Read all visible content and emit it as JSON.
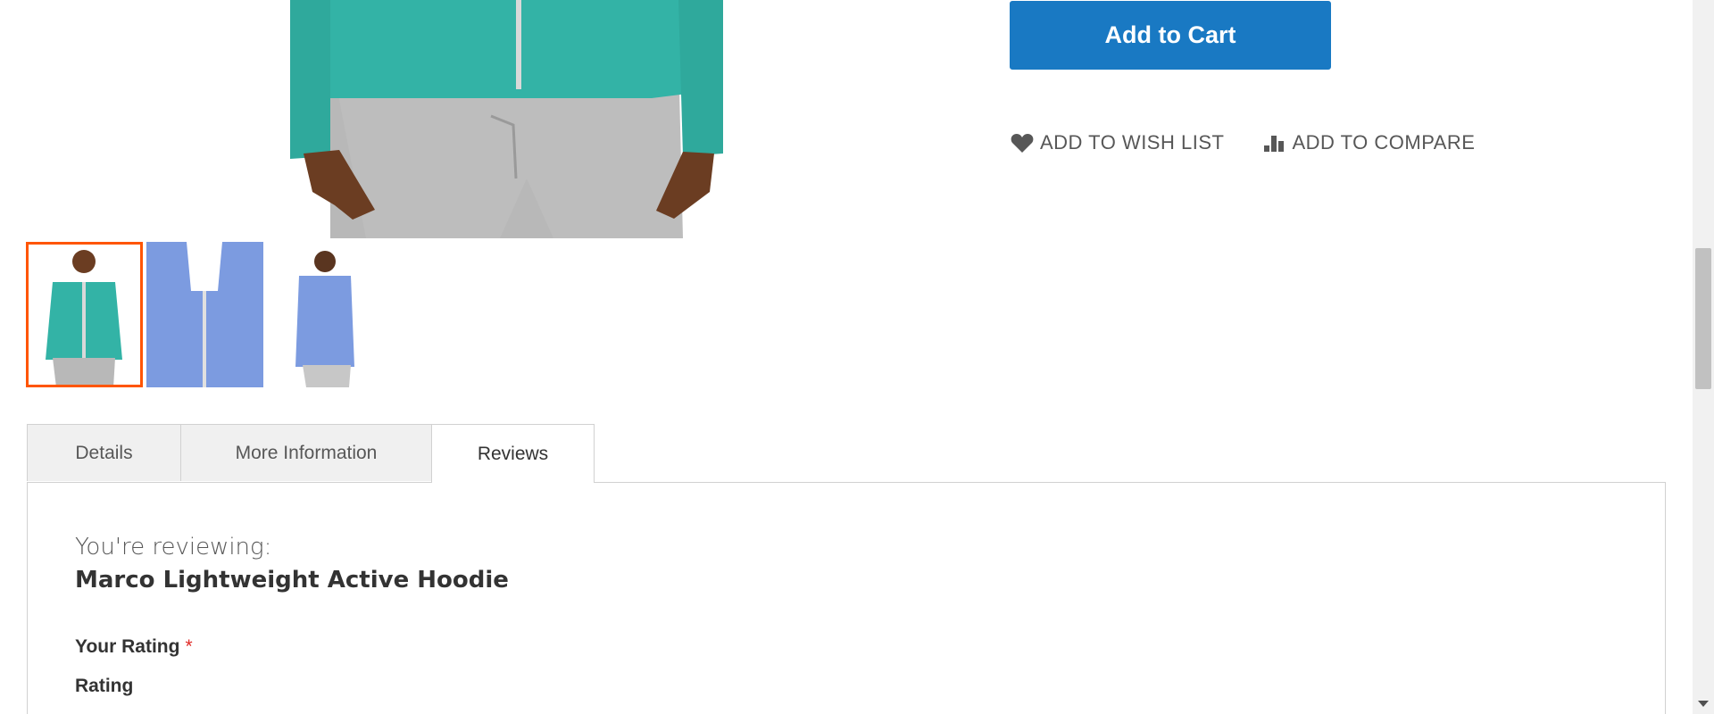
{
  "product": {
    "add_to_cart_label": "Add to Cart",
    "wishlist_label": "ADD TO WISH LIST",
    "compare_label": "ADD TO COMPARE",
    "colors": {
      "primary_button": "#1979c3",
      "active_thumb_border": "#ff5501",
      "hoodie_teal": "#33b3a6",
      "hoodie_blue": "#7c9be0",
      "required_star": "#e02b27"
    }
  },
  "tabs": [
    {
      "label": "Details",
      "active": false
    },
    {
      "label": "More Information",
      "active": false
    },
    {
      "label": "Reviews",
      "active": true
    }
  ],
  "review": {
    "reviewing_label": "You're reviewing:",
    "product_name": "Marco Lightweight Active Hoodie",
    "rating_label": "Your Rating",
    "required_marker": "*",
    "rating_sub_label": "Rating"
  }
}
